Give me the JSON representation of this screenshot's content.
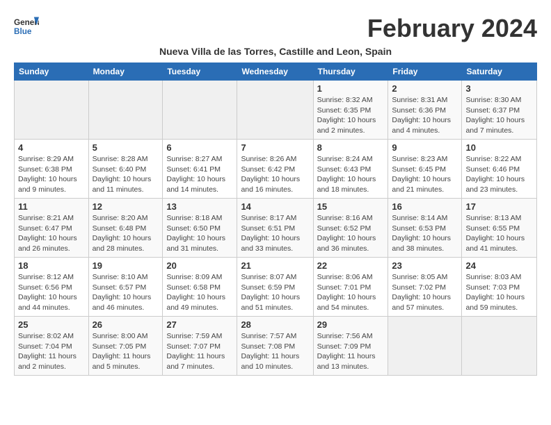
{
  "header": {
    "logo_general": "General",
    "logo_blue": "Blue",
    "month_title": "February 2024",
    "subtitle": "Nueva Villa de las Torres, Castille and Leon, Spain"
  },
  "calendar": {
    "days_of_week": [
      "Sunday",
      "Monday",
      "Tuesday",
      "Wednesday",
      "Thursday",
      "Friday",
      "Saturday"
    ],
    "weeks": [
      [
        {
          "day": "",
          "info": ""
        },
        {
          "day": "",
          "info": ""
        },
        {
          "day": "",
          "info": ""
        },
        {
          "day": "",
          "info": ""
        },
        {
          "day": "1",
          "info": "Sunrise: 8:32 AM\nSunset: 6:35 PM\nDaylight: 10 hours\nand 2 minutes."
        },
        {
          "day": "2",
          "info": "Sunrise: 8:31 AM\nSunset: 6:36 PM\nDaylight: 10 hours\nand 4 minutes."
        },
        {
          "day": "3",
          "info": "Sunrise: 8:30 AM\nSunset: 6:37 PM\nDaylight: 10 hours\nand 7 minutes."
        }
      ],
      [
        {
          "day": "4",
          "info": "Sunrise: 8:29 AM\nSunset: 6:38 PM\nDaylight: 10 hours\nand 9 minutes."
        },
        {
          "day": "5",
          "info": "Sunrise: 8:28 AM\nSunset: 6:40 PM\nDaylight: 10 hours\nand 11 minutes."
        },
        {
          "day": "6",
          "info": "Sunrise: 8:27 AM\nSunset: 6:41 PM\nDaylight: 10 hours\nand 14 minutes."
        },
        {
          "day": "7",
          "info": "Sunrise: 8:26 AM\nSunset: 6:42 PM\nDaylight: 10 hours\nand 16 minutes."
        },
        {
          "day": "8",
          "info": "Sunrise: 8:24 AM\nSunset: 6:43 PM\nDaylight: 10 hours\nand 18 minutes."
        },
        {
          "day": "9",
          "info": "Sunrise: 8:23 AM\nSunset: 6:45 PM\nDaylight: 10 hours\nand 21 minutes."
        },
        {
          "day": "10",
          "info": "Sunrise: 8:22 AM\nSunset: 6:46 PM\nDaylight: 10 hours\nand 23 minutes."
        }
      ],
      [
        {
          "day": "11",
          "info": "Sunrise: 8:21 AM\nSunset: 6:47 PM\nDaylight: 10 hours\nand 26 minutes."
        },
        {
          "day": "12",
          "info": "Sunrise: 8:20 AM\nSunset: 6:48 PM\nDaylight: 10 hours\nand 28 minutes."
        },
        {
          "day": "13",
          "info": "Sunrise: 8:18 AM\nSunset: 6:50 PM\nDaylight: 10 hours\nand 31 minutes."
        },
        {
          "day": "14",
          "info": "Sunrise: 8:17 AM\nSunset: 6:51 PM\nDaylight: 10 hours\nand 33 minutes."
        },
        {
          "day": "15",
          "info": "Sunrise: 8:16 AM\nSunset: 6:52 PM\nDaylight: 10 hours\nand 36 minutes."
        },
        {
          "day": "16",
          "info": "Sunrise: 8:14 AM\nSunset: 6:53 PM\nDaylight: 10 hours\nand 38 minutes."
        },
        {
          "day": "17",
          "info": "Sunrise: 8:13 AM\nSunset: 6:55 PM\nDaylight: 10 hours\nand 41 minutes."
        }
      ],
      [
        {
          "day": "18",
          "info": "Sunrise: 8:12 AM\nSunset: 6:56 PM\nDaylight: 10 hours\nand 44 minutes."
        },
        {
          "day": "19",
          "info": "Sunrise: 8:10 AM\nSunset: 6:57 PM\nDaylight: 10 hours\nand 46 minutes."
        },
        {
          "day": "20",
          "info": "Sunrise: 8:09 AM\nSunset: 6:58 PM\nDaylight: 10 hours\nand 49 minutes."
        },
        {
          "day": "21",
          "info": "Sunrise: 8:07 AM\nSunset: 6:59 PM\nDaylight: 10 hours\nand 51 minutes."
        },
        {
          "day": "22",
          "info": "Sunrise: 8:06 AM\nSunset: 7:01 PM\nDaylight: 10 hours\nand 54 minutes."
        },
        {
          "day": "23",
          "info": "Sunrise: 8:05 AM\nSunset: 7:02 PM\nDaylight: 10 hours\nand 57 minutes."
        },
        {
          "day": "24",
          "info": "Sunrise: 8:03 AM\nSunset: 7:03 PM\nDaylight: 10 hours\nand 59 minutes."
        }
      ],
      [
        {
          "day": "25",
          "info": "Sunrise: 8:02 AM\nSunset: 7:04 PM\nDaylight: 11 hours\nand 2 minutes."
        },
        {
          "day": "26",
          "info": "Sunrise: 8:00 AM\nSunset: 7:05 PM\nDaylight: 11 hours\nand 5 minutes."
        },
        {
          "day": "27",
          "info": "Sunrise: 7:59 AM\nSunset: 7:07 PM\nDaylight: 11 hours\nand 7 minutes."
        },
        {
          "day": "28",
          "info": "Sunrise: 7:57 AM\nSunset: 7:08 PM\nDaylight: 11 hours\nand 10 minutes."
        },
        {
          "day": "29",
          "info": "Sunrise: 7:56 AM\nSunset: 7:09 PM\nDaylight: 11 hours\nand 13 minutes."
        },
        {
          "day": "",
          "info": ""
        },
        {
          "day": "",
          "info": ""
        }
      ]
    ]
  }
}
